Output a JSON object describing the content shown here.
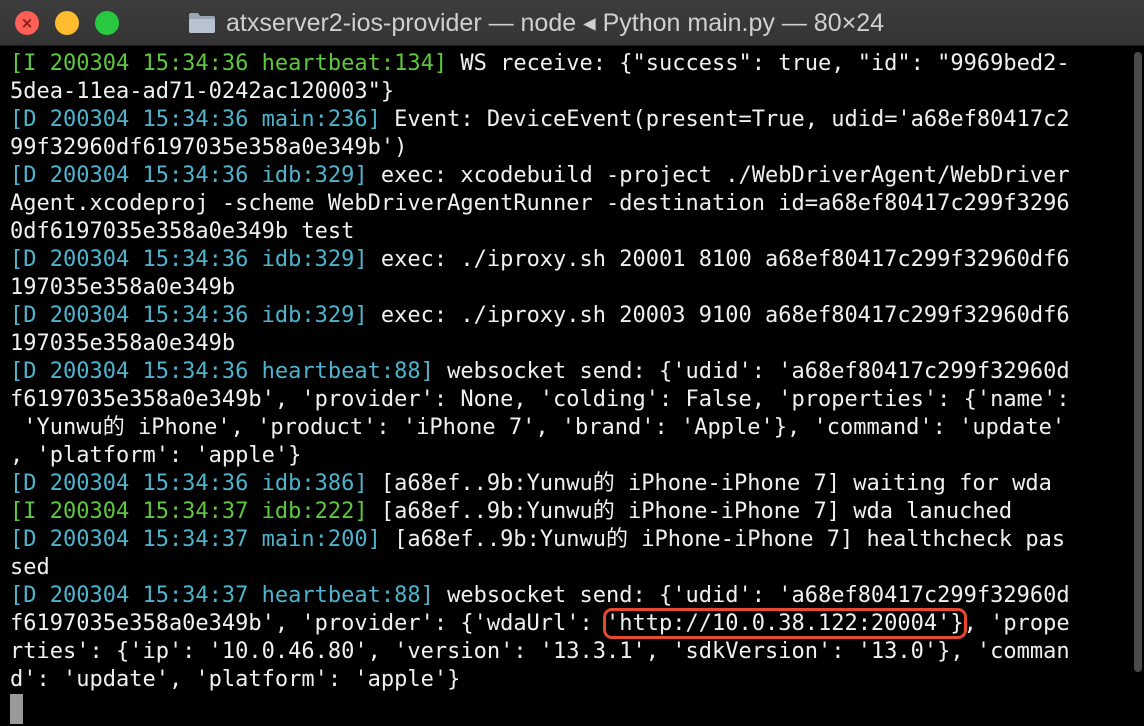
{
  "window": {
    "title": "atxserver2-ios-provider — node ◂ Python main.py — 80×24",
    "colors": {
      "close": "#fe5f57",
      "minimize": "#febc2e",
      "maximize": "#28c840"
    }
  },
  "terminal": {
    "lines": [
      [
        {
          "t": "[I 200304 15:34:36 heartbeat:134]",
          "c": "g"
        },
        {
          "t": " WS receive: {\"success\": true, \"id\": \"9969bed2-"
        }
      ],
      [
        {
          "t": "5dea-11ea-ad71-0242ac120003\"}"
        }
      ],
      [
        {
          "t": "[D 200304 15:34:36 main:236]",
          "c": "c"
        },
        {
          "t": " Event: DeviceEvent(present=True, udid='a68ef80417c2"
        }
      ],
      [
        {
          "t": "99f32960df6197035e358a0e349b')"
        }
      ],
      [
        {
          "t": "[D 200304 15:34:36 idb:329]",
          "c": "c"
        },
        {
          "t": " exec: xcodebuild -project ./WebDriverAgent/WebDriver"
        }
      ],
      [
        {
          "t": "Agent.xcodeproj -scheme WebDriverAgentRunner -destination id=a68ef80417c299f3296"
        }
      ],
      [
        {
          "t": "0df6197035e358a0e349b test"
        }
      ],
      [
        {
          "t": "[D 200304 15:34:36 idb:329]",
          "c": "c"
        },
        {
          "t": " exec: ./iproxy.sh 20001 8100 a68ef80417c299f32960df6"
        }
      ],
      [
        {
          "t": "197035e358a0e349b"
        }
      ],
      [
        {
          "t": "[D 200304 15:34:36 idb:329]",
          "c": "c"
        },
        {
          "t": " exec: ./iproxy.sh 20003 9100 a68ef80417c299f32960df6"
        }
      ],
      [
        {
          "t": "197035e358a0e349b"
        }
      ],
      [
        {
          "t": "[D 200304 15:34:36 heartbeat:88]",
          "c": "c"
        },
        {
          "t": " websocket send: {'udid': 'a68ef80417c299f32960d"
        }
      ],
      [
        {
          "t": "f6197035e358a0e349b', 'provider': None, 'colding': False, 'properties': {'name':"
        }
      ],
      [
        {
          "t": " 'Yunwu的 iPhone', 'product': 'iPhone 7', 'brand': 'Apple'}, 'command': 'update'"
        }
      ],
      [
        {
          "t": ", 'platform': 'apple'}"
        }
      ],
      [
        {
          "t": "[D 200304 15:34:36 idb:386]",
          "c": "c"
        },
        {
          "t": " [a68ef..9b:Yunwu的 iPhone-iPhone 7] waiting for wda"
        }
      ],
      [
        {
          "t": "[I 200304 15:34:37 idb:222]",
          "c": "g"
        },
        {
          "t": " [a68ef..9b:Yunwu的 iPhone-iPhone 7] wda lanuched"
        }
      ],
      [
        {
          "t": "[D 200304 15:34:37 main:200]",
          "c": "c"
        },
        {
          "t": " [a68ef..9b:Yunwu的 iPhone-iPhone 7] healthcheck pas"
        }
      ],
      [
        {
          "t": "sed"
        }
      ],
      [
        {
          "t": "[D 200304 15:34:37 heartbeat:88]",
          "c": "c"
        },
        {
          "t": " websocket send: {'udid': 'a68ef80417c299f32960d"
        }
      ],
      [
        {
          "t": "f6197035e358a0e349b', 'provider': {'wdaUrl': "
        },
        {
          "t": "'http://10.0.38.122:20004'}",
          "c": "hl"
        },
        {
          "t": ", 'prope"
        }
      ],
      [
        {
          "t": "rties': {'ip': '10.0.46.80', 'version': '13.3.1', 'sdkVersion': '13.0'}, 'comman"
        }
      ],
      [
        {
          "t": "d': 'update', 'platform': 'apple'}"
        }
      ]
    ]
  }
}
